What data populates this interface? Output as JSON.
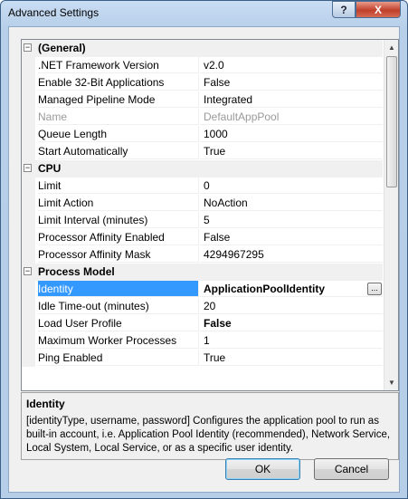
{
  "window": {
    "title": "Advanced Settings",
    "help_label": "?",
    "close_label": "X"
  },
  "categories": [
    {
      "name": "(General)",
      "expander": "−",
      "properties": [
        {
          "name": ".NET Framework Version",
          "value": "v2.0"
        },
        {
          "name": "Enable 32-Bit Applications",
          "value": "False"
        },
        {
          "name": "Managed Pipeline Mode",
          "value": "Integrated"
        },
        {
          "name": "Name",
          "value": "DefaultAppPool"
        },
        {
          "name": "Queue Length",
          "value": "1000"
        },
        {
          "name": "Start Automatically",
          "value": "True"
        }
      ]
    },
    {
      "name": "CPU",
      "expander": "−",
      "properties": [
        {
          "name": "Limit",
          "value": "0"
        },
        {
          "name": "Limit Action",
          "value": "NoAction"
        },
        {
          "name": "Limit Interval (minutes)",
          "value": "5"
        },
        {
          "name": "Processor Affinity Enabled",
          "value": "False"
        },
        {
          "name": "Processor Affinity Mask",
          "value": "4294967295"
        }
      ]
    },
    {
      "name": "Process Model",
      "expander": "−",
      "properties": [
        {
          "name": "Identity",
          "value": "ApplicationPoolIdentity"
        },
        {
          "name": "Idle Time-out (minutes)",
          "value": "20"
        },
        {
          "name": "Load User Profile",
          "value": "False"
        },
        {
          "name": "Maximum Worker Processes",
          "value": "1"
        },
        {
          "name": "Ping Enabled",
          "value": "True"
        }
      ]
    }
  ],
  "ellipsis_label": "...",
  "scroll": {
    "up": "▲",
    "down": "▼"
  },
  "description": {
    "title": "Identity",
    "text": "[identityType, username, password] Configures the application pool to run as built-in account, i.e. Application Pool Identity (recommended), Network Service, Local System, Local Service, or as a specific user identity."
  },
  "buttons": {
    "ok": "OK",
    "cancel": "Cancel"
  }
}
